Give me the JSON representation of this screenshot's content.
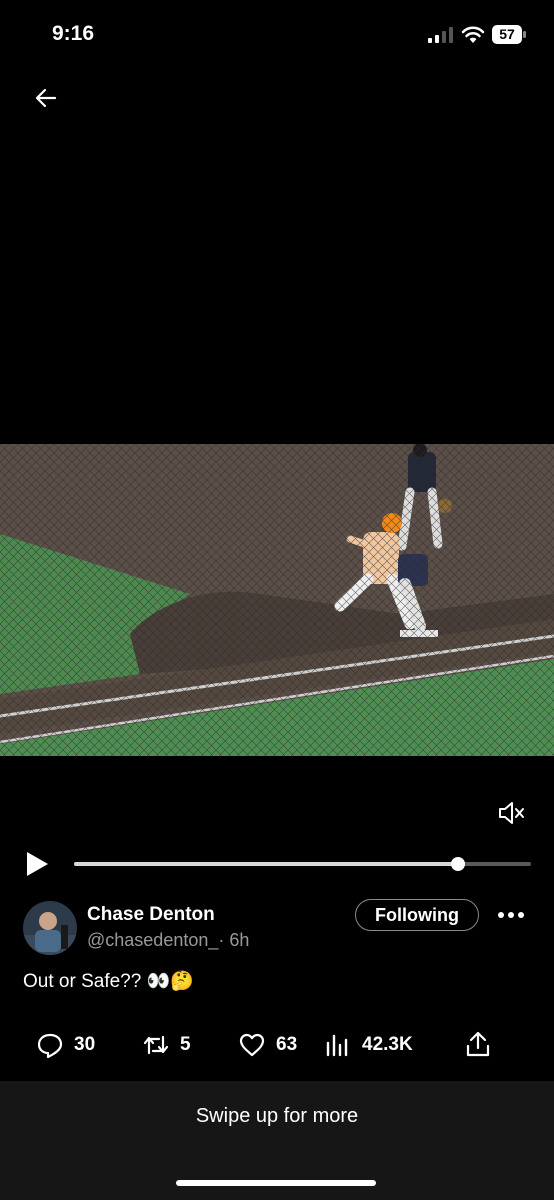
{
  "status_bar": {
    "time": "9:16",
    "battery": "57"
  },
  "video": {
    "progress": 0.84
  },
  "tweet": {
    "author_name": "Chase Denton",
    "handle": "@chasedenton_",
    "age": "· 6h",
    "follow_label": "Following",
    "text": "Out or Safe?? 👀🤔"
  },
  "actions": {
    "replies": "30",
    "reposts": "5",
    "likes": "63",
    "views": "42.3K"
  },
  "footer": {
    "swipe_label": "Swipe up for more"
  }
}
